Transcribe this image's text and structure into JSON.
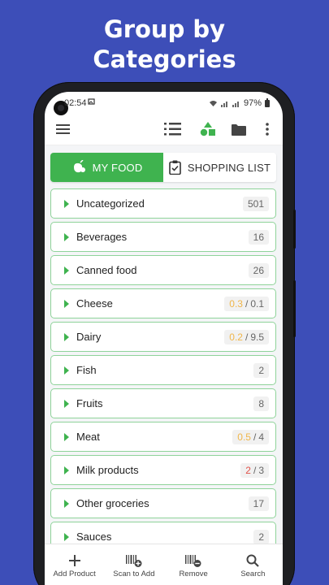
{
  "promo": {
    "title_line1": "Group by",
    "title_line2": "Categories"
  },
  "status_bar": {
    "time": "02:54",
    "notification_icon": "gallery-icon",
    "battery": "97%"
  },
  "toolbar": {
    "icons": [
      "menu-icon",
      "list-view-icon",
      "categories-icon",
      "folder-icon",
      "more-icon"
    ]
  },
  "tabs": [
    {
      "label": "MY FOOD",
      "icon": "food-icon",
      "active": true
    },
    {
      "label": "SHOPPING LIST",
      "icon": "clipboard-icon",
      "active": false
    }
  ],
  "categories": [
    {
      "name": "Uncategorized",
      "count": "501"
    },
    {
      "name": "Beverages",
      "count": "16"
    },
    {
      "name": "Canned food",
      "count": "26"
    },
    {
      "name": "Cheese",
      "count_left": "0.3",
      "count_right": "0.1",
      "left_color": "orange"
    },
    {
      "name": "Dairy",
      "count_left": "0.2",
      "count_right": "9.5",
      "left_color": "orange"
    },
    {
      "name": "Fish",
      "count": "2"
    },
    {
      "name": "Fruits",
      "count": "8"
    },
    {
      "name": "Meat",
      "count_left": "0.5",
      "count_right": "4",
      "left_color": "orange"
    },
    {
      "name": "Milk products",
      "count_left": "2",
      "count_right": "3",
      "left_color": "red"
    },
    {
      "name": "Other groceries",
      "count": "17"
    },
    {
      "name": "Sauces",
      "count": "2"
    }
  ],
  "bottom_nav": [
    {
      "label": "Add Product",
      "icon": "plus-icon"
    },
    {
      "label": "Scan to Add",
      "icon": "barcode-add-icon"
    },
    {
      "label": "Remove",
      "icon": "barcode-remove-icon"
    },
    {
      "label": "Search",
      "icon": "search-icon"
    }
  ],
  "colors": {
    "background": "#3d4eb8",
    "accent": "#3fb34f",
    "row_border": "#8fd39a",
    "expiring": "#f0b64a",
    "expired": "#e0524a"
  }
}
